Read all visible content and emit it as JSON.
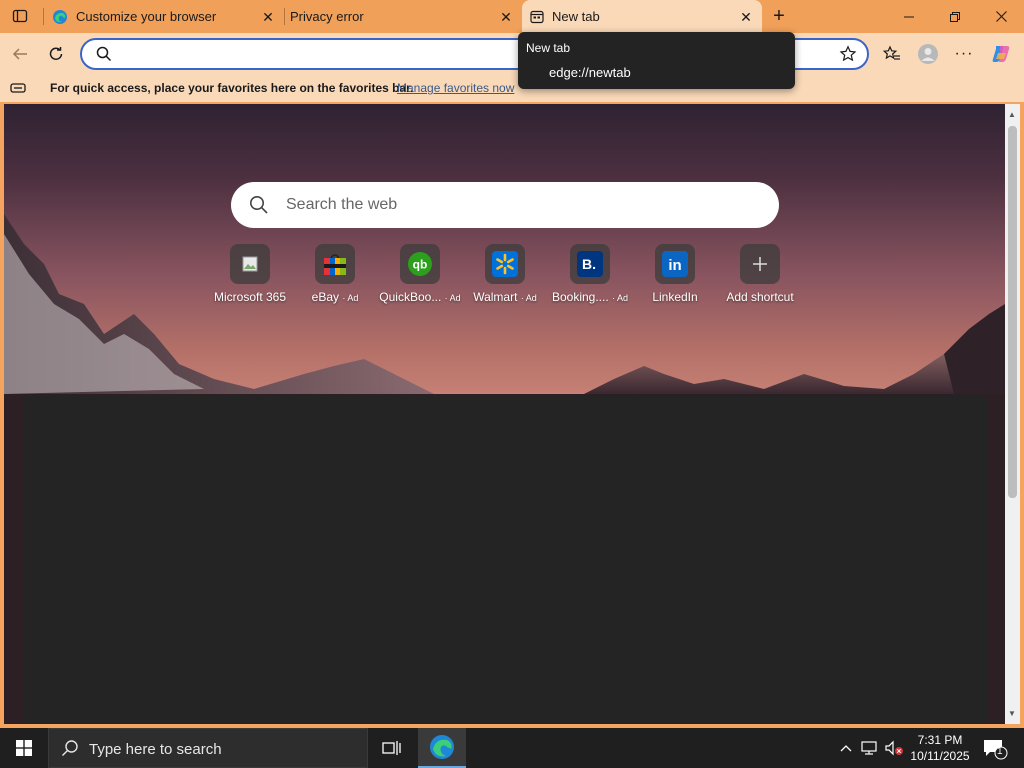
{
  "tabs": [
    {
      "title": "Customize your browser",
      "active": false
    },
    {
      "title": "Privacy error",
      "active": false
    },
    {
      "title": "New tab",
      "active": true
    }
  ],
  "address": {
    "value": ""
  },
  "suggestion": {
    "title": "New tab",
    "url": "edge://newtab"
  },
  "favorites_bar": {
    "message": "For quick access, place your favorites here on the favorites bar.",
    "link": "Manage favorites now"
  },
  "new_tab_page": {
    "search_placeholder": "Search the web",
    "shortcuts": [
      {
        "label": "Microsoft 365",
        "ad": ""
      },
      {
        "label": "eBay",
        "ad": "· Ad"
      },
      {
        "label": "QuickBoo...",
        "ad": "· Ad"
      },
      {
        "label": "Walmart",
        "ad": "· Ad"
      },
      {
        "label": "Booking....",
        "ad": "· Ad"
      },
      {
        "label": "LinkedIn",
        "ad": ""
      },
      {
        "label": "Add shortcut",
        "ad": ""
      }
    ]
  },
  "taskbar": {
    "search_placeholder": "Type here to search",
    "time": "7:31 PM",
    "date": "10/11/2025",
    "notification_count": "1"
  },
  "colors": {
    "tab_strip": "#F0A059",
    "toolbar": "#FAD9B8",
    "address_border": "#3A64C8",
    "taskbar": "#1f1f1f"
  }
}
